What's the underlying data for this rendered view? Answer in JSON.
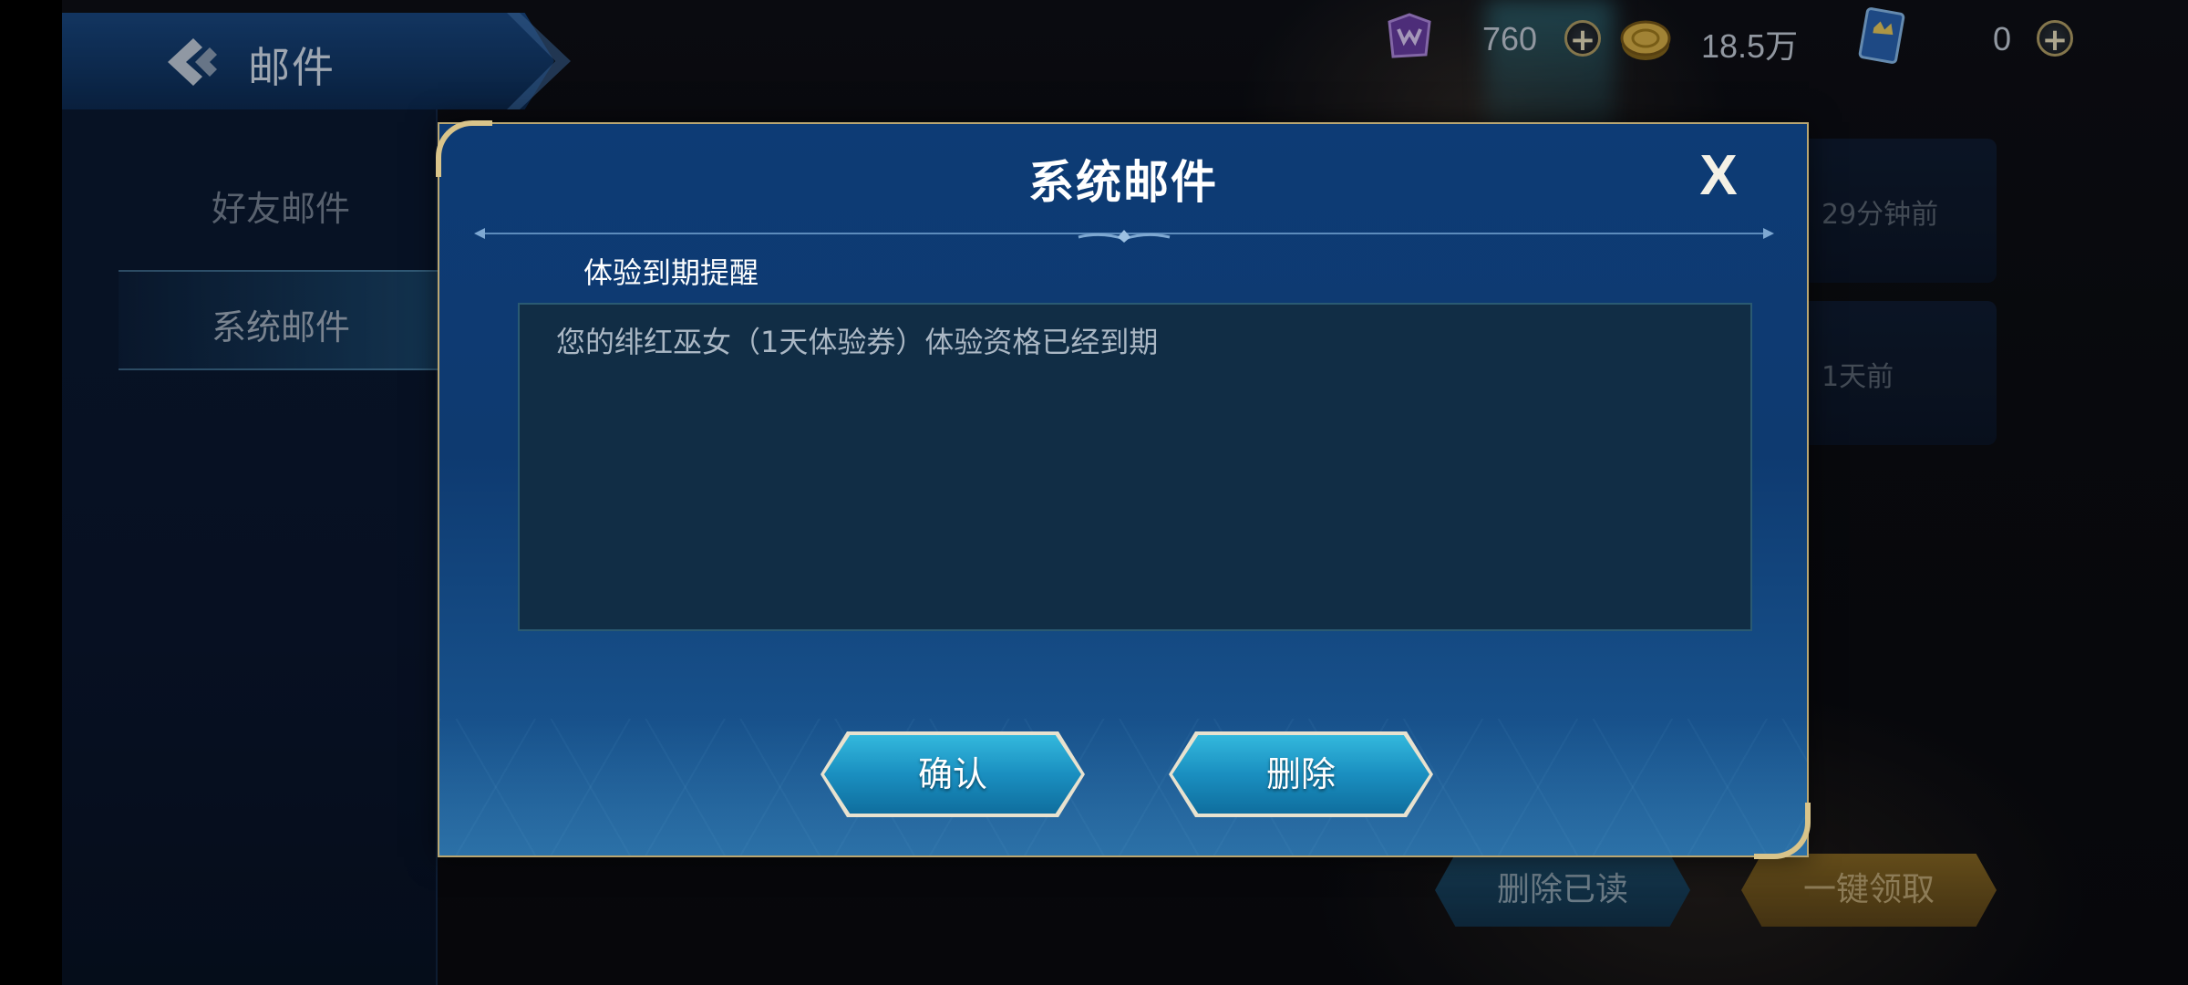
{
  "header": {
    "title": "邮件"
  },
  "currencies": [
    {
      "icon": "puzzle-token-icon",
      "value": "760"
    },
    {
      "icon": "gold-coin-icon",
      "value": "18.5万"
    },
    {
      "icon": "card-ticket-icon",
      "value": "0"
    }
  ],
  "sidebar": {
    "tabs": [
      {
        "label": "好友邮件",
        "active": false
      },
      {
        "label": "系统邮件",
        "active": true
      }
    ]
  },
  "mail_list": {
    "items": [
      {
        "time": "29分钟前"
      },
      {
        "time": "1天前"
      }
    ]
  },
  "footer": {
    "delete_read_label": "删除已读",
    "claim_all_label": "一键领取"
  },
  "dialog": {
    "title": "系统邮件",
    "close_label": "X",
    "subject": "体验到期提醒",
    "body": "您的绯红巫女（1天体验券）体验资格已经到期",
    "confirm_label": "确认",
    "delete_label": "删除"
  },
  "colors": {
    "dialog_border": "#b9a672",
    "button_blue": "#1a8fc0",
    "claim_gold": "#8a6a24"
  }
}
